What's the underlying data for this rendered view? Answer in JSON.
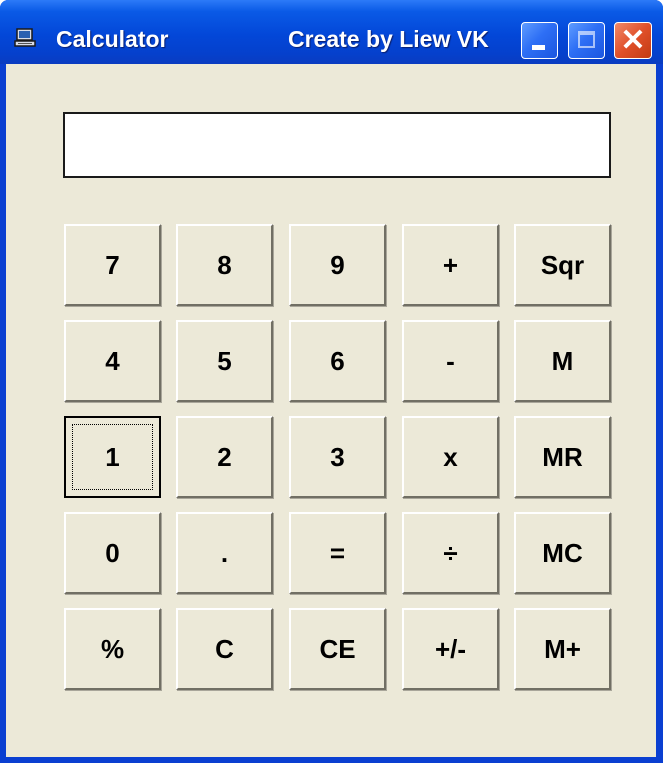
{
  "window": {
    "title": "Calculator",
    "author": "Create by Liew VK",
    "controls": {
      "minimize_icon": "minimize-icon",
      "maximize_icon": "maximize-icon",
      "close_glyph": "✕"
    },
    "colors": {
      "titlebar": "#0347d8",
      "client": "#ece9d8",
      "close": "#e0502a"
    }
  },
  "display": {
    "value": ""
  },
  "keys": {
    "r1": [
      "7",
      "8",
      "9",
      "+",
      "Sqr"
    ],
    "r2": [
      "4",
      "5",
      "6",
      "-",
      "M"
    ],
    "r3": [
      "1",
      "2",
      "3",
      "x",
      "MR"
    ],
    "r4": [
      "0",
      ".",
      "=",
      "÷",
      "MC"
    ],
    "r5": [
      "%",
      "C",
      "CE",
      "+/-",
      "M+"
    ]
  },
  "focused_key": "1"
}
